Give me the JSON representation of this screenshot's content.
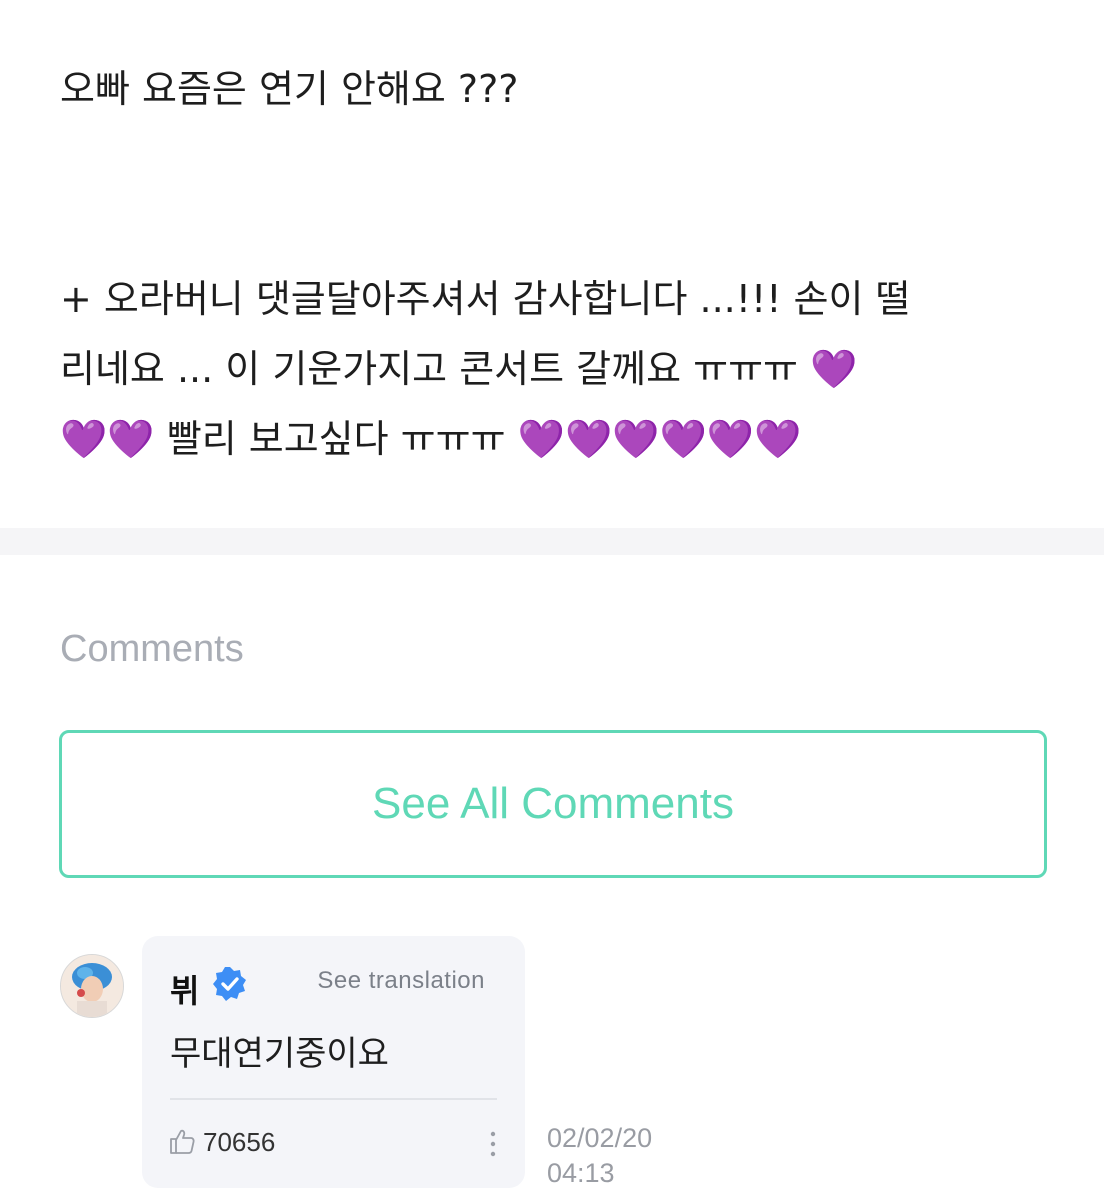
{
  "post": {
    "line1": "오빠 요즘은 연기 안해요 ???",
    "line2": "+ 오라버니 댓글달아주셔서 감사합니다 ...!!! 손이 떨",
    "line3_text": "리네요 ... 이 기운가지고 콘서트 갈께요 ㅠㅠㅠ",
    "line3_hearts": "💜",
    "line4_hearts_start": "💜💜",
    "line4_text": "빨리 보고싶다 ㅠㅠㅠ",
    "line4_hearts_end": "💜💜💜💜💜💜"
  },
  "comments": {
    "heading": "Comments",
    "see_all_label": "See All Comments"
  },
  "comment": {
    "author": "뷔",
    "verified_icon": "verified-check-icon",
    "see_translation": "See translation",
    "text": "무대연기중이요",
    "likes": "70656",
    "date": "02/02/20",
    "time": "04:13"
  },
  "colors": {
    "accent": "#5fd8b6",
    "verified": "#3d8ef5",
    "heart": "#9b4dea",
    "muted": "#a9adb5"
  }
}
